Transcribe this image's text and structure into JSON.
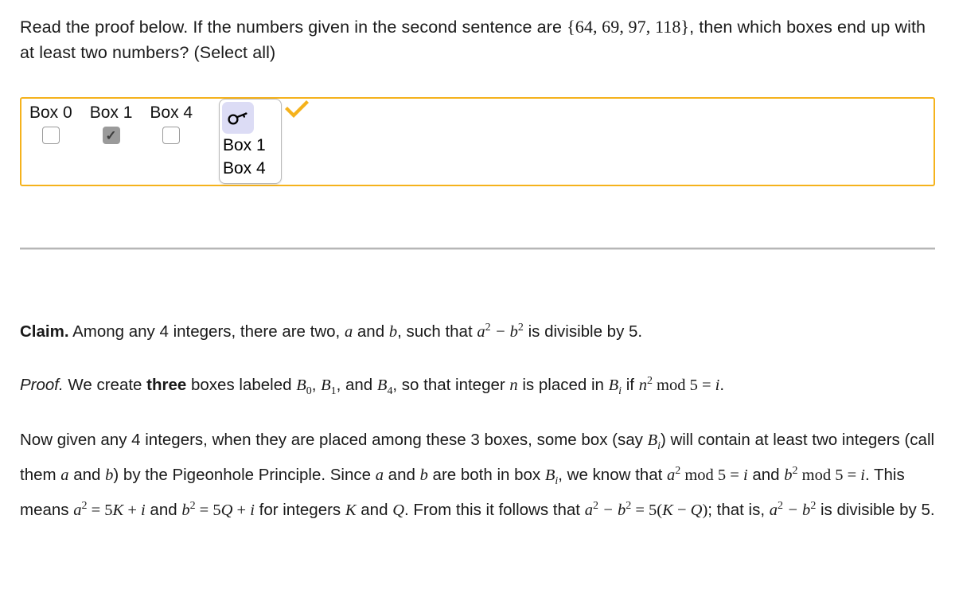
{
  "prompt": {
    "part1": "Read the proof below. If the numbers given in the second sentence are ",
    "numbers": "{64, 69, 97, 118}",
    "part2": ", then which boxes end up with at least two numbers? (Select all)"
  },
  "answer_area": {
    "border_color": "#f5b21c",
    "choices": [
      {
        "label": "Box 0",
        "checked": false
      },
      {
        "label": "Box 1",
        "checked": true
      },
      {
        "label": "Box 4",
        "checked": false
      }
    ],
    "key_panel": {
      "icon": "key-icon",
      "icon_background": "#dcdcf5",
      "answers": [
        "Box 1",
        "Box 4"
      ]
    },
    "correct_marker": {
      "icon": "check-mark-icon",
      "color": "#f5b21c"
    }
  },
  "proof": {
    "claim": {
      "lead": "Claim.",
      "text_a": " Among any 4 integers, there are two, ",
      "var_a": "a",
      "text_b": " and ",
      "var_b": "b",
      "text_c": ", such that ",
      "expr": "a2 − b2",
      "text_d": " is divisible by 5."
    },
    "proof_setup": {
      "lead": "Proof.",
      "text_a": " We create ",
      "bold_word": "three",
      "text_b": " boxes labeled ",
      "b0": "B0",
      "text_c": ", ",
      "b1": "B1",
      "text_d": ", and ",
      "b4": "B4",
      "text_e": ", so that integer ",
      "var_n": "n",
      "text_f": " is placed in ",
      "bi": "Bi",
      "text_g": " if ",
      "expr": "n2 mod 5 = i",
      "text_h": "."
    },
    "body": {
      "t1": "Now given any 4 integers, when they are placed among these 3 boxes, some box (say ",
      "bi1": "Bi",
      "t2": ") will contain at least two integers (call them ",
      "va": "a",
      "t3": " and ",
      "vb": "b",
      "t4": ") by the Pigeonhole Principle. Since ",
      "va2": "a",
      "t5": " and ",
      "vb2": "b",
      "t6": " are both in box ",
      "bi2": "Bi",
      "t7": ", we know that ",
      "e1": "a2 mod 5 = i",
      "t8": " and ",
      "e2": "b2 mod 5 = i",
      "t9": ". This means ",
      "e3": "a2 = 5K + i",
      "t10": " and ",
      "e4": "b2 = 5Q + i",
      "t11": " for integers ",
      "vK": "K",
      "t12": " and ",
      "vQ": "Q",
      "t13": ". From this it follows that ",
      "e5": "a2 − b2 = 5(K − Q)",
      "t14": "; that is, ",
      "e6": "a2 − b2",
      "t15": " is divisible by 5."
    }
  }
}
